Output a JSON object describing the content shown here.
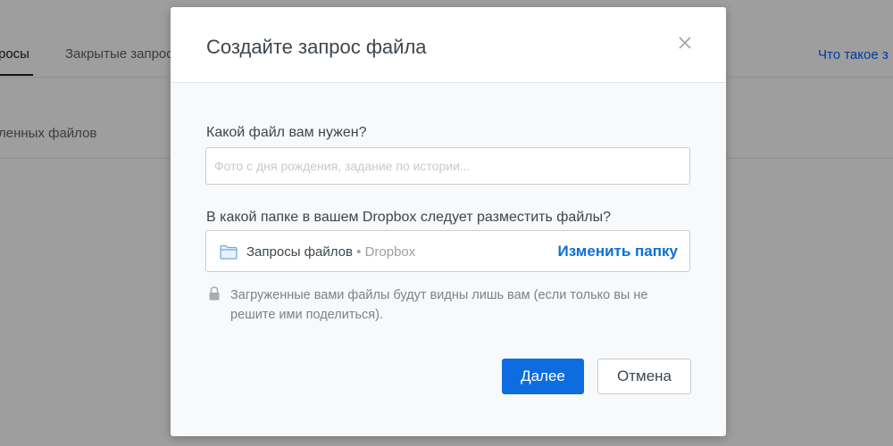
{
  "background": {
    "tabs": [
      {
        "label": "росы",
        "active": true
      },
      {
        "label": "Закрытые запрос",
        "active": false
      }
    ],
    "help_link": "Что такое з",
    "section_label": "ленных файлов"
  },
  "modal": {
    "title": "Создайте запрос файла",
    "close_icon": "close-icon",
    "file_question": "Какой файл вам нужен?",
    "file_placeholder": "Фото с дня рождения, задание по истории...",
    "folder_question": "В какой папке в вашем Dropbox следует разместить файлы?",
    "folder": {
      "name": "Запросы файлов",
      "separator": "•",
      "root": "Dropbox",
      "change_label": "Изменить папку"
    },
    "privacy_note": "Загруженные вами файлы будут видны лишь вам (если только вы не решите ими поделиться).",
    "next_label": "Далее",
    "cancel_label": "Отмена"
  },
  "colors": {
    "accent": "#0d6de0",
    "link": "#0b6fd0",
    "overlay": "rgba(0,0,0,0.38)"
  }
}
